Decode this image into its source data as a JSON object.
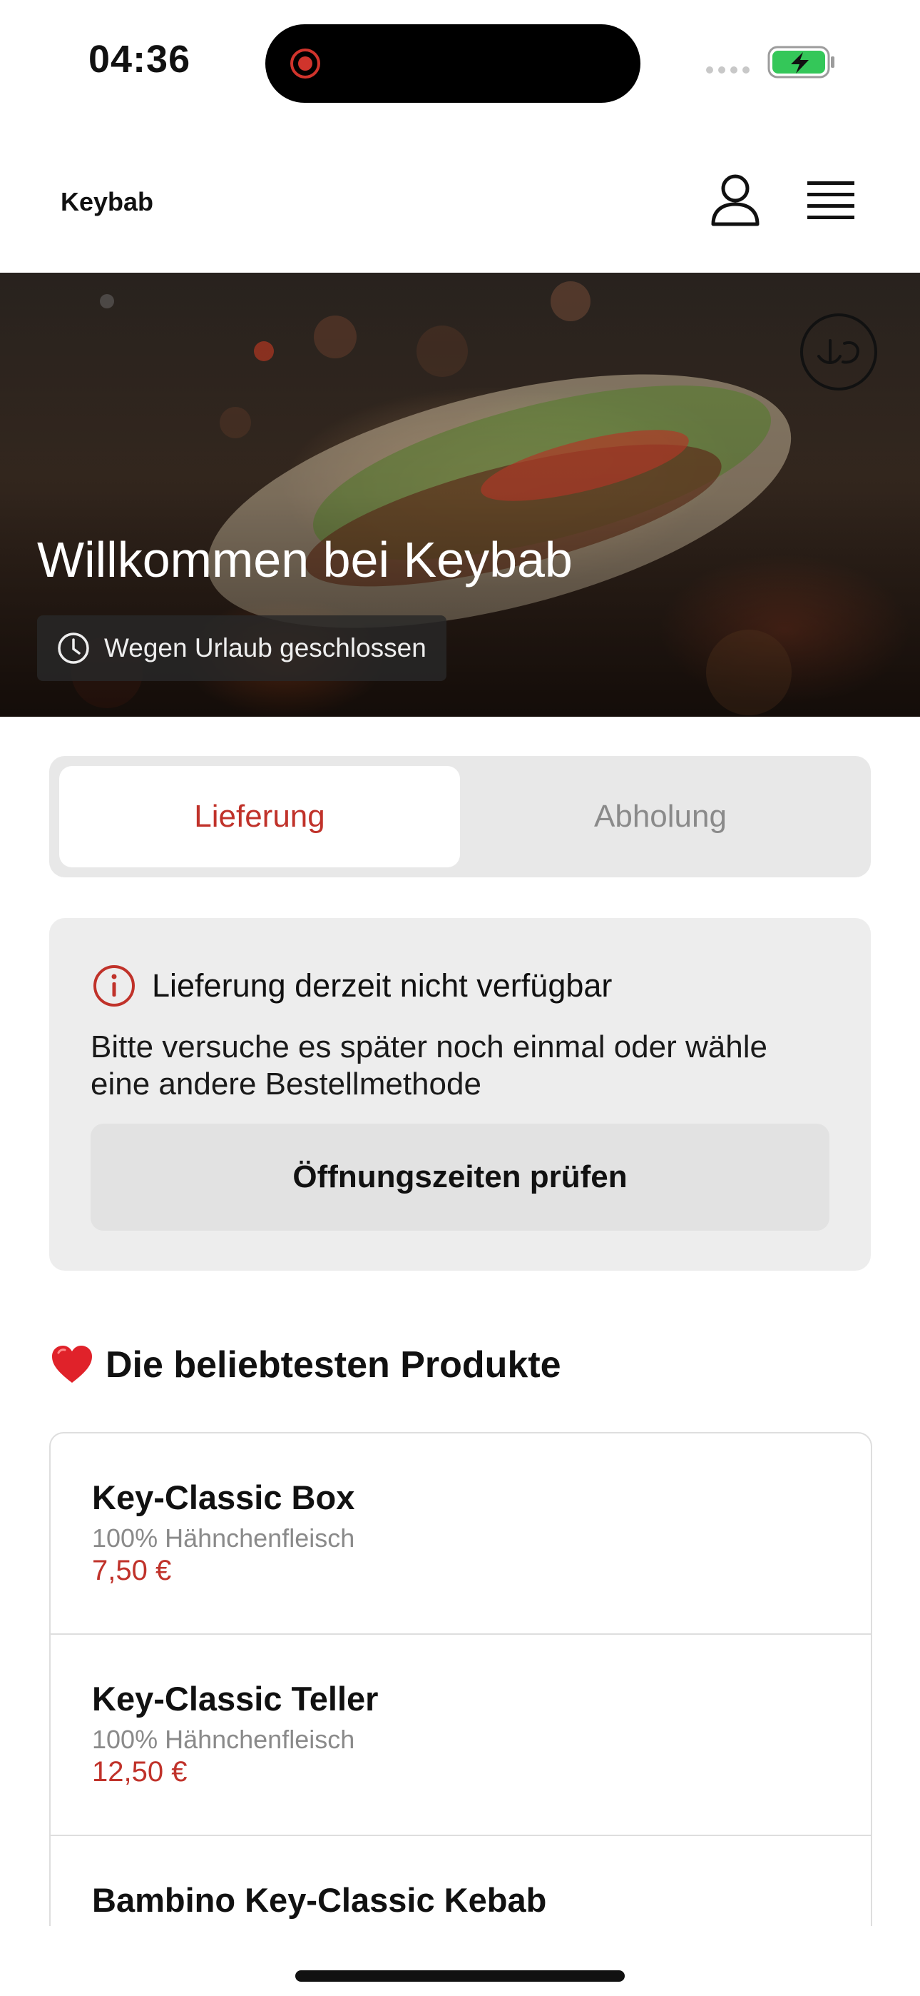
{
  "status_bar": {
    "time": "04:36",
    "recording_icon": "record-icon",
    "signal_icon": "signal-dots-icon",
    "battery_icon": "battery-charging-icon",
    "battery_color": "#34c759"
  },
  "header": {
    "brand": "Keybab",
    "account_icon": "user-icon",
    "menu_icon": "hamburger-menu-icon"
  },
  "hero": {
    "title": "Willkommen bei Keybab",
    "status_icon": "clock-icon",
    "status": "Wegen Urlaub geschlossen",
    "badge_icon": "halal-logo"
  },
  "order_mode": {
    "tabs": [
      "Lieferung",
      "Abholung"
    ],
    "selected": "Lieferung"
  },
  "notice": {
    "icon": "info-icon",
    "title": "Lieferung derzeit nicht verfügbar",
    "body": "Bitte versuche es später noch einmal oder wähle eine andere Bestellmethode",
    "button": "Öffnungszeiten prüfen"
  },
  "popular": {
    "icon": "heart-icon",
    "title": "Die beliebtesten Produkte",
    "products": [
      {
        "name": "Key-Classic Box",
        "description": "100% Hähnchenfleisch",
        "price": "7,50 €"
      },
      {
        "name": "Key-Classic Teller",
        "description": "100% Hähnchenfleisch",
        "price": "12,50 €"
      },
      {
        "name": "Bambino Key-Classic Kebab"
      }
    ]
  },
  "colors": {
    "accent": "#c0322a",
    "segment_bg": "#e8e8e8",
    "notice_bg": "#ededed",
    "muted_text": "#8a8a8a"
  }
}
